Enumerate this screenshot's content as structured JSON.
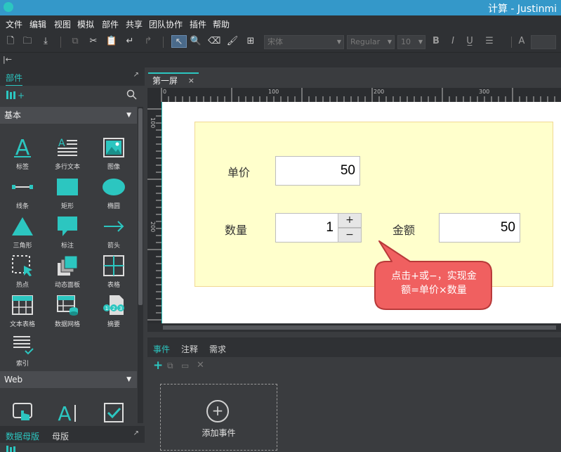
{
  "window": {
    "title": "计算 - Justinmi"
  },
  "menu": [
    "文件",
    "编辑",
    "视图",
    "模拟",
    "部件",
    "共享",
    "团队协作",
    "插件",
    "帮助"
  ],
  "toolbar": {
    "font_family": "宋体",
    "font_style": "Regular",
    "font_size": "10",
    "bold": "B",
    "italic": "I",
    "font_color_icon": "A"
  },
  "left_panel": {
    "tab_widgets": "部件",
    "category_basic": "基本",
    "category_web": "Web",
    "widgets_basic": [
      "标签",
      "多行文本",
      "图像",
      "线条",
      "矩形",
      "椭圆",
      "三角形",
      "标注",
      "箭头",
      "热点",
      "动态面板",
      "表格",
      "文本表格",
      "数据网格",
      "摘要",
      "索引"
    ],
    "widgets_web_icons": [
      "A"
    ],
    "tab_data_masters": "数据母版",
    "tab_masters": "母版"
  },
  "document": {
    "tab_title": "第一屏",
    "tab_close": "×",
    "ruler_h_labels": [
      "0",
      "100",
      "200",
      "300"
    ],
    "ruler_v_labels": [
      "100",
      "200"
    ]
  },
  "canvas": {
    "unit_price_label": "单价",
    "unit_price_value": "50",
    "quantity_label": "数量",
    "quantity_value": "1",
    "stepper_plus": "+",
    "stepper_minus": "−",
    "amount_label": "金额",
    "amount_value": "50",
    "callout_line1": "点击+或−，实现金",
    "callout_line2": "额=单价×数量"
  },
  "bottom_panel": {
    "tab_events": "事件",
    "tab_notes": "注释",
    "tab_requirements": "需求",
    "add_event": "添加事件",
    "add_event_plus": "+"
  },
  "colors": {
    "accent": "#2cc6c0",
    "title_bar": "#3498c9",
    "panel_bg": "#ffffcc",
    "callout_fill": "#f06060"
  }
}
